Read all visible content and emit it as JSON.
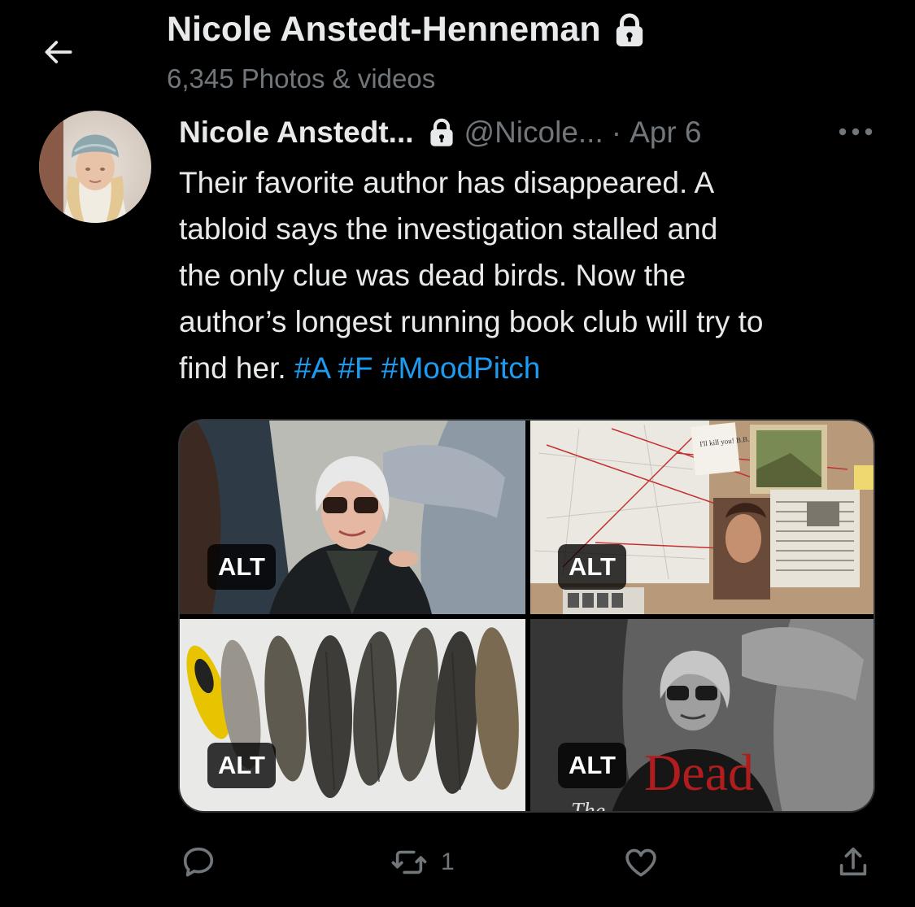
{
  "header": {
    "title": "Nicole Anstedt-Henneman",
    "subtitle": "6,345 Photos & videos"
  },
  "tweet": {
    "display_name": "Nicole Anstedt...",
    "handle": "@Nicole...",
    "separator": "·",
    "date": "Apr 6",
    "text_lines": [
      "Their favorite author has disappeared. A",
      "tabloid says the investigation stalled and",
      "the only clue was dead birds. Now the",
      "author’s longest running book club will try to"
    ],
    "last_line_text": "find her.",
    "hashtags": [
      "#A",
      "#F",
      "#MoodPitch"
    ],
    "media_alt_labels": [
      "ALT",
      "ALT",
      "ALT",
      "ALT"
    ],
    "media_overlay": {
      "cover_title": "Dead",
      "cover_subtitle": "The",
      "note_text": "I'll kill you! B.B."
    }
  },
  "actions": {
    "retweet_count": "1"
  },
  "colors": {
    "background": "#000000",
    "text_primary": "#e7e9ea",
    "text_secondary": "#71767b",
    "link": "#1d9bf0",
    "cover_title_red": "#b11d1d"
  },
  "icons": [
    "back-arrow-icon",
    "lock-icon",
    "more-icon",
    "reply-icon",
    "retweet-icon",
    "like-icon",
    "share-icon"
  ]
}
